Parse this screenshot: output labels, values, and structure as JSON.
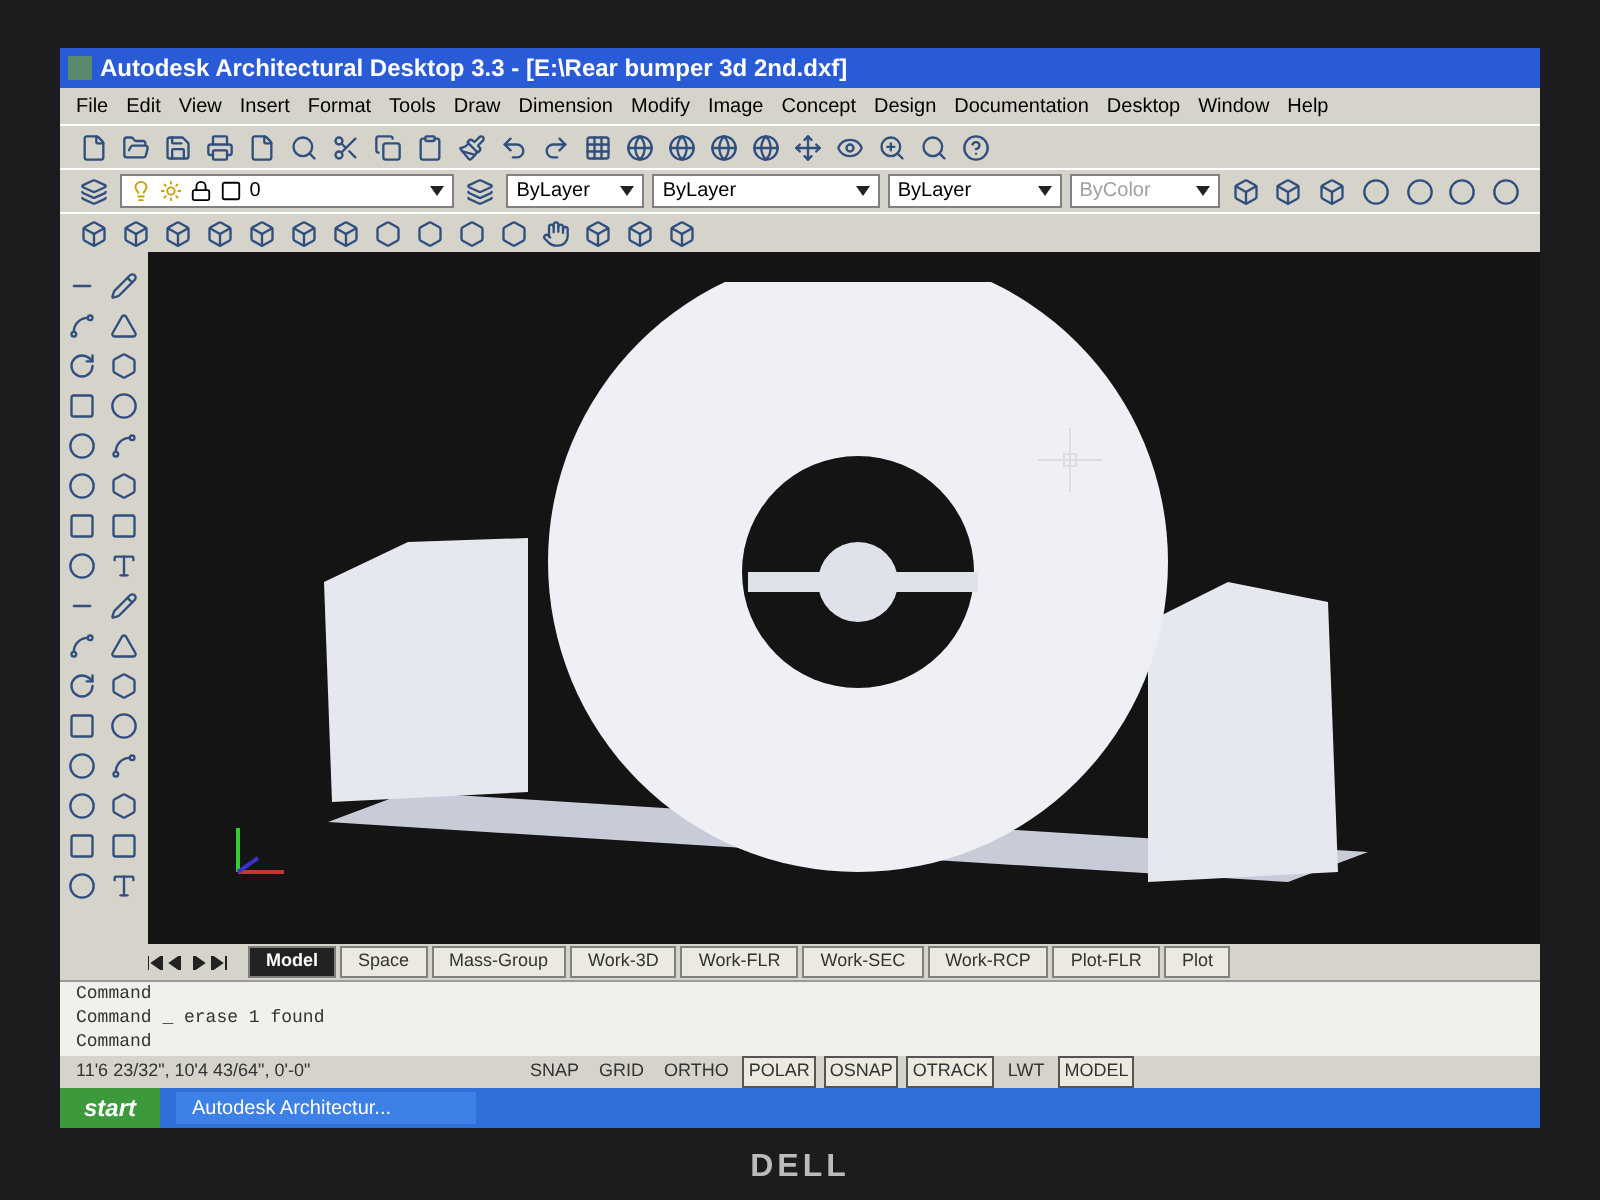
{
  "window": {
    "title": "Autodesk Architectural Desktop 3.3 - [E:\\Rear bumper 3d 2nd.dxf]"
  },
  "menu": [
    "File",
    "Edit",
    "View",
    "Insert",
    "Format",
    "Tools",
    "Draw",
    "Dimension",
    "Modify",
    "Image",
    "Concept",
    "Design",
    "Documentation",
    "Desktop",
    "Window",
    "Help"
  ],
  "properties": {
    "layer": "0",
    "color_control": "ByLayer",
    "linetype": "ByLayer",
    "lineweight": "ByLayer",
    "plot_style": {
      "value": "ByColor",
      "disabled": true
    }
  },
  "layout_tabs": [
    {
      "label": "Model",
      "selected": true
    },
    {
      "label": "Space",
      "selected": false
    },
    {
      "label": "Mass-Group",
      "selected": false
    },
    {
      "label": "Work-3D",
      "selected": false
    },
    {
      "label": "Work-FLR",
      "selected": false
    },
    {
      "label": "Work-SEC",
      "selected": false
    },
    {
      "label": "Work-RCP",
      "selected": false
    },
    {
      "label": "Plot-FLR",
      "selected": false
    },
    {
      "label": "Plot",
      "selected": false
    }
  ],
  "command_lines": [
    "Command",
    "Command _ erase 1 found",
    "Command"
  ],
  "status_bar": {
    "coordinates": "11'6 23/32\", 10'4 43/64\", 0'-0\"",
    "toggles": [
      {
        "label": "SNAP",
        "on": false
      },
      {
        "label": "GRID",
        "on": false
      },
      {
        "label": "ORTHO",
        "on": false
      },
      {
        "label": "POLAR",
        "on": true
      },
      {
        "label": "OSNAP",
        "on": true
      },
      {
        "label": "OTRACK",
        "on": true
      },
      {
        "label": "LWT",
        "on": false
      },
      {
        "label": "MODEL",
        "on": true
      }
    ]
  },
  "taskbar": {
    "start": "start",
    "task": "Autodesk Architectur..."
  },
  "bezel": {
    "logo": "DELL"
  }
}
